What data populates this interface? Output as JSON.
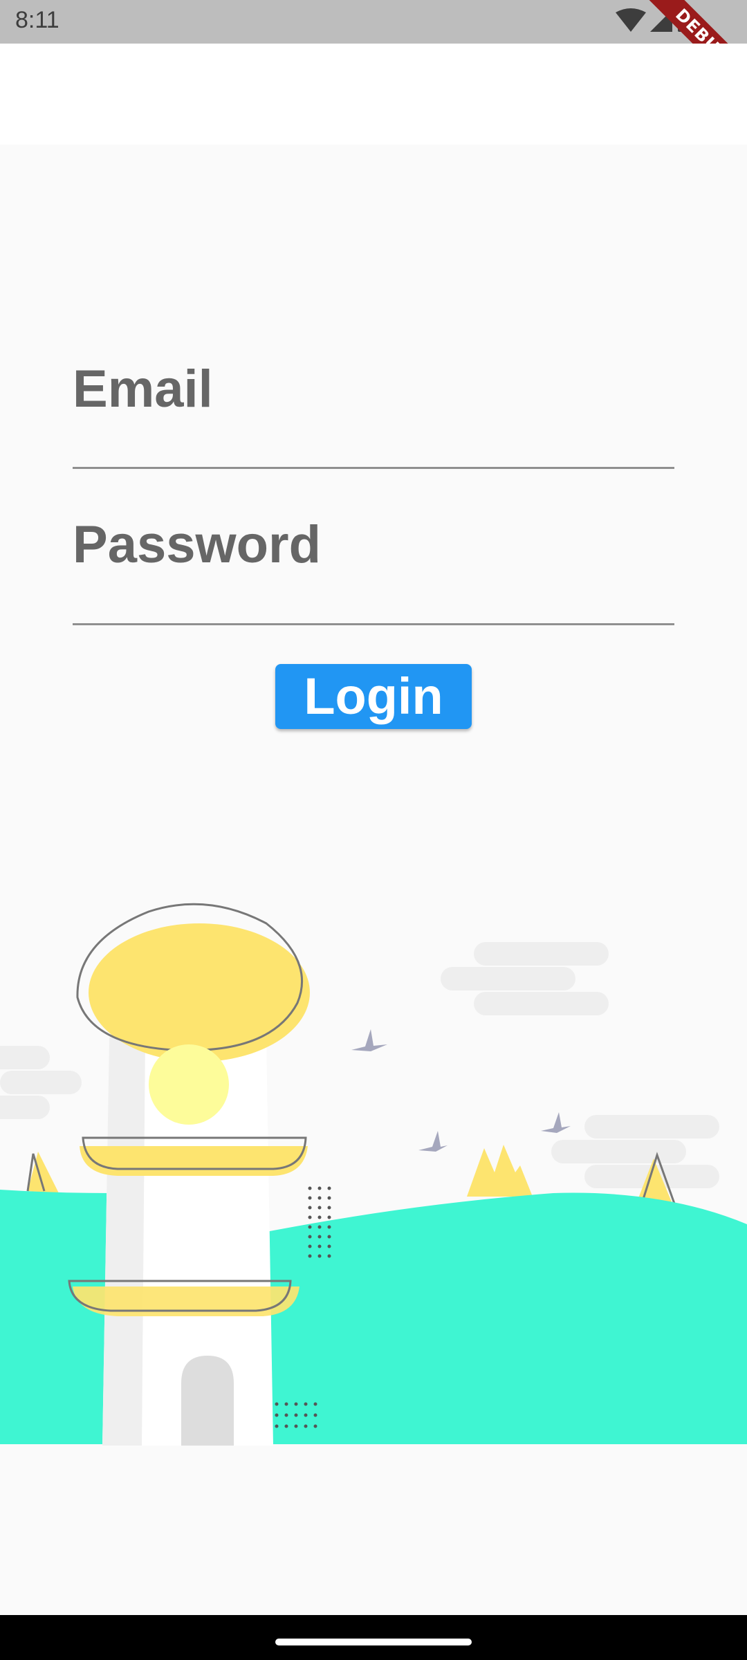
{
  "status_bar": {
    "time": "8:11"
  },
  "debug_banner": {
    "label": "DEBUG"
  },
  "login_form": {
    "email_placeholder": "Email",
    "password_placeholder": "Password",
    "login_label": "Login"
  },
  "colors": {
    "primary": "#2196f3",
    "label_gray": "#666666",
    "hill_teal": "#3ff5d2",
    "lighthouse_yellow": "#fde46f",
    "background": "#fafafa"
  },
  "icons": [
    "wifi-icon",
    "cellular-signal-icon",
    "battery-icon"
  ]
}
